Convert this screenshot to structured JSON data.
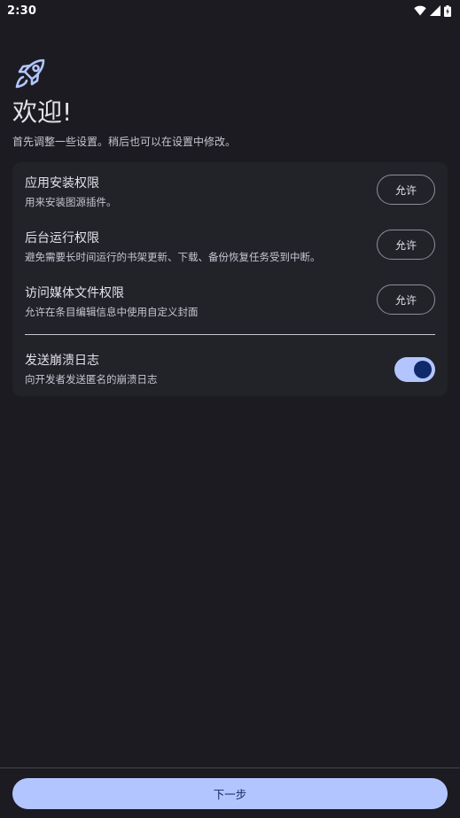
{
  "status_bar": {
    "time": "2:30",
    "icons": [
      "wifi-icon",
      "signal-icon",
      "battery-charging-icon"
    ]
  },
  "header": {
    "logo_icon": "rocket-icon",
    "title": "欢迎!",
    "subtitle": "首先调整一些设置。稍后也可以在设置中修改。"
  },
  "permissions": [
    {
      "title": "应用安装权限",
      "description": "用来安装图源插件。",
      "button_label": "允许"
    },
    {
      "title": "后台运行权限",
      "description": "避免需要长时间运行的书架更新、下载、备份恢复任务受到中断。",
      "button_label": "允许"
    },
    {
      "title": "访问媒体文件权限",
      "description": "允许在条目编辑信息中使用自定义封面",
      "button_label": "允许"
    }
  ],
  "crash_log": {
    "title": "发送崩溃日志",
    "description": "向开发者发送匿名的崩溃日志",
    "enabled": true
  },
  "footer": {
    "next_label": "下一步"
  },
  "colors": {
    "background": "#1b1b21",
    "card": "#222229",
    "accent": "#b3c5ff",
    "on_accent": "#0f2a6b"
  }
}
